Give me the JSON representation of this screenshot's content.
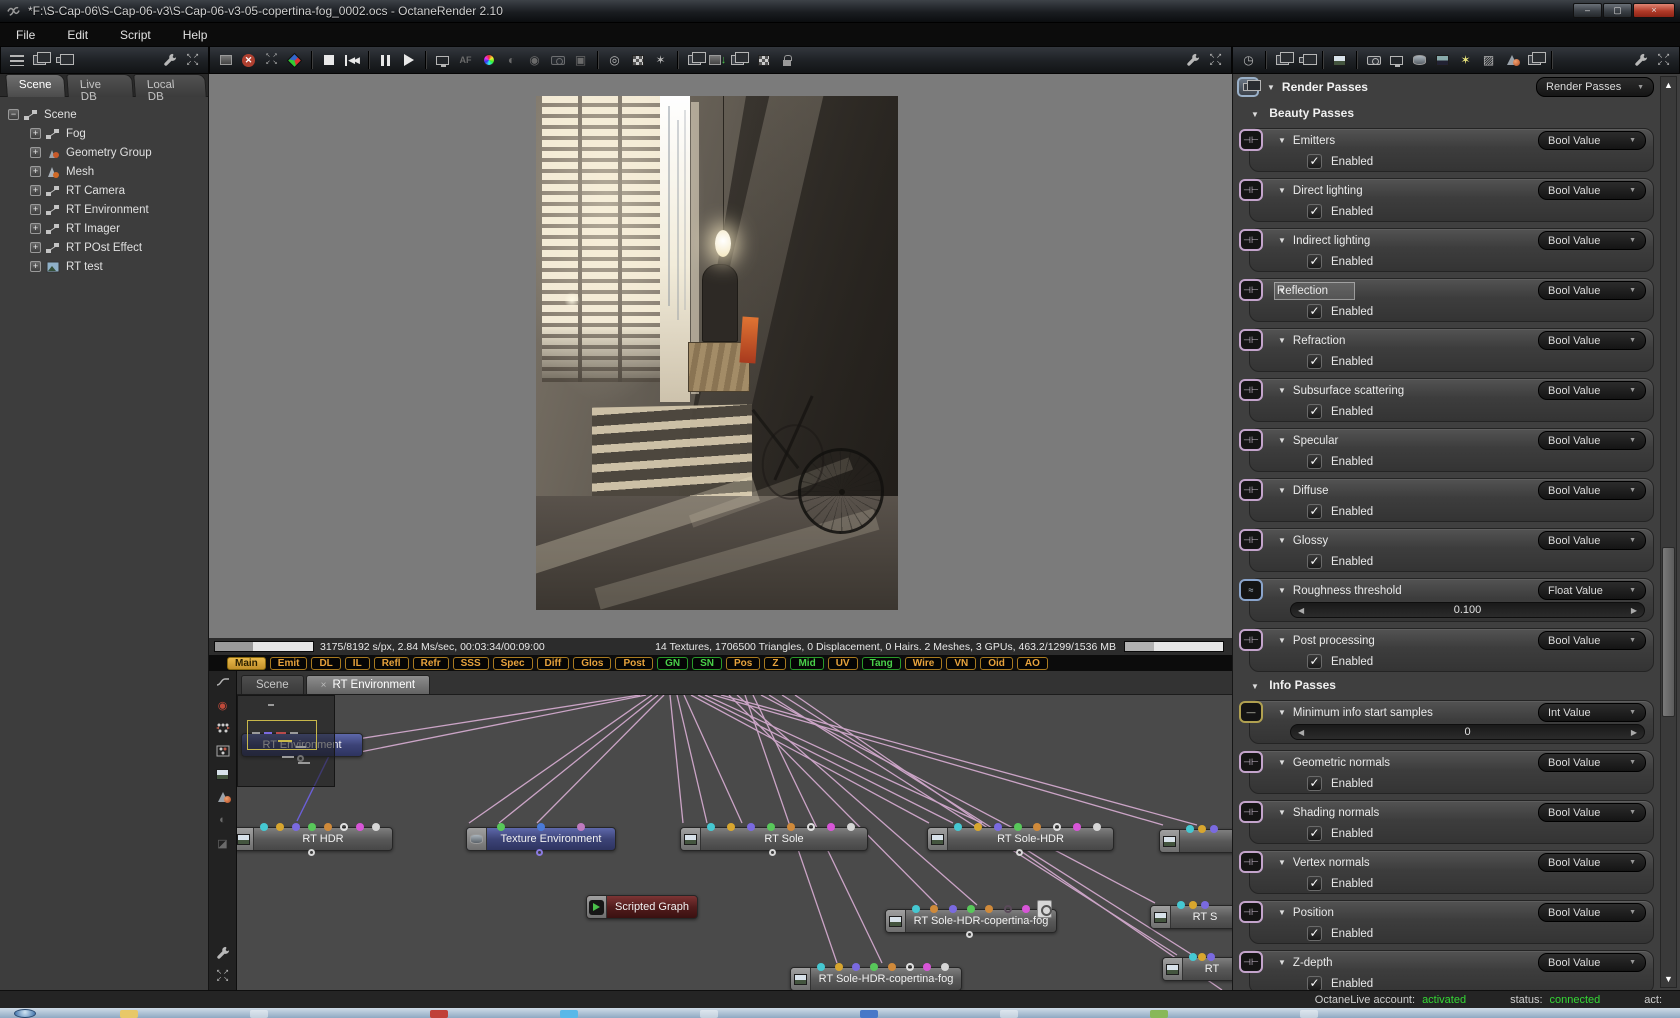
{
  "window": {
    "title": "*F:\\S-Cap-06\\S-Cap-06-v3\\S-Cap-06-v3-05-copertina-fog_0002.ocs - OctaneRender 2.10",
    "menus": [
      "File",
      "Edit",
      "Script",
      "Help"
    ],
    "controls": {
      "minimize": "–",
      "maximize": "▢",
      "close": "×"
    }
  },
  "icons": {
    "collapse": "▼",
    "check": "✓",
    "left": "◀",
    "right": "▶",
    "up": "▲",
    "down": "▼",
    "close": "×",
    "rewind": "◀◀",
    "af": "AF",
    "no": "✕"
  },
  "left_panel": {
    "tabs": [
      "Scene",
      "Live DB",
      "Local DB"
    ],
    "tree": [
      {
        "label": "Scene",
        "expander": "−"
      },
      {
        "label": "Fog",
        "expander": "+"
      },
      {
        "label": "Geometry Group",
        "expander": "+"
      },
      {
        "label": "Mesh",
        "expander": "+"
      },
      {
        "label": "RT Camera",
        "expander": "+"
      },
      {
        "label": "RT Environment",
        "expander": "+"
      },
      {
        "label": "RT Imager",
        "expander": "+"
      },
      {
        "label": "RT POst Effect",
        "expander": "+"
      },
      {
        "label": "RT test",
        "expander": "+"
      }
    ]
  },
  "viewport": {
    "status_left": "3175/8192 s/px, 2.84 Ms/sec, 00:03:34/00:09:00",
    "status_right": "14 Textures, 1706500 Triangles, 0 Displacement, 0 Hairs. 2 Meshes, 3 GPUs, 463.2/1299/1536 MB",
    "progress_percent": 39
  },
  "passes_toolbar": [
    {
      "label": "Main",
      "style": "active"
    },
    {
      "label": "Emit",
      "style": "orange"
    },
    {
      "label": "DL",
      "style": "orange"
    },
    {
      "label": "IL",
      "style": "orange"
    },
    {
      "label": "Refl",
      "style": "orange"
    },
    {
      "label": "Refr",
      "style": "orange"
    },
    {
      "label": "SSS",
      "style": "orange"
    },
    {
      "label": "Spec",
      "style": "orange"
    },
    {
      "label": "Diff",
      "style": "orange"
    },
    {
      "label": "Glos",
      "style": "orange"
    },
    {
      "label": "Post",
      "style": "orange"
    },
    {
      "label": "GN",
      "style": "green"
    },
    {
      "label": "SN",
      "style": "green"
    },
    {
      "label": "Pos",
      "style": "orange"
    },
    {
      "label": "Z",
      "style": "orange"
    },
    {
      "label": "Mid",
      "style": "green"
    },
    {
      "label": "UV",
      "style": "orange"
    },
    {
      "label": "Tang",
      "style": "green"
    },
    {
      "label": "Wire",
      "style": "orange"
    },
    {
      "label": "VN",
      "style": "orange"
    },
    {
      "label": "Oid",
      "style": "orange"
    },
    {
      "label": "AO",
      "style": "orange"
    }
  ],
  "nodegraph": {
    "tabs": [
      "Scene",
      "RT Environment"
    ],
    "nodes": [
      {
        "label": "RT HDR"
      },
      {
        "label": "RT Environment"
      },
      {
        "label": "Texture Environment"
      },
      {
        "label": "RT Sole"
      },
      {
        "label": "RT Sole-HDR"
      },
      {
        "label": "Scripted Graph"
      },
      {
        "label": "RT Sole-HDR-copertina-fog"
      },
      {
        "label": "RT Sole-HDR-copertina-fog"
      },
      {
        "label": ""
      },
      {
        "label": "RT S"
      },
      {
        "label": "RT"
      }
    ]
  },
  "inspector": {
    "header": "Render Passes",
    "header_dropdown": "Render Passes",
    "enabled_label": "Enabled",
    "rows": [
      {
        "kind": "section",
        "label": "Beauty Passes"
      },
      {
        "kind": "bool",
        "label": "Emitters",
        "value_type": "Bool Value"
      },
      {
        "kind": "bool",
        "label": "Direct lighting",
        "value_type": "Bool Value"
      },
      {
        "kind": "bool",
        "label": "Indirect lighting",
        "value_type": "Bool Value"
      },
      {
        "kind": "bool",
        "label": "Reflection",
        "value_type": "Bool Value"
      },
      {
        "kind": "bool",
        "label": "Refraction",
        "value_type": "Bool Value"
      },
      {
        "kind": "bool",
        "label": "Subsurface scattering",
        "value_type": "Bool Value"
      },
      {
        "kind": "bool",
        "label": "Specular",
        "value_type": "Bool Value"
      },
      {
        "kind": "bool",
        "label": "Diffuse",
        "value_type": "Bool Value"
      },
      {
        "kind": "bool",
        "label": "Glossy",
        "value_type": "Bool Value"
      },
      {
        "kind": "float",
        "label": "Roughness threshold",
        "value_type": "Float Value",
        "value": "0.100"
      },
      {
        "kind": "bool",
        "label": "Post processing",
        "value_type": "Bool Value"
      },
      {
        "kind": "section",
        "label": "Info Passes"
      },
      {
        "kind": "int",
        "label": "Minimum info start samples",
        "value_type": "Int Value",
        "value": "0"
      },
      {
        "kind": "bool",
        "label": "Geometric normals",
        "value_type": "Bool Value"
      },
      {
        "kind": "bool",
        "label": "Shading normals",
        "value_type": "Bool Value"
      },
      {
        "kind": "bool",
        "label": "Vertex normals",
        "value_type": "Bool Value"
      },
      {
        "kind": "bool",
        "label": "Position",
        "value_type": "Bool Value"
      },
      {
        "kind": "bool",
        "label": "Z-depth",
        "value_type": "Bool Value"
      }
    ]
  },
  "statusbar": {
    "account_label": "OctaneLive account:",
    "account_value": "activated",
    "status_label": "status:",
    "status_value": "connected",
    "act_label": "act:"
  },
  "colors": {
    "pass_orange": "#e8a33d",
    "pass_green": "#4ad04a",
    "status_green": "#35d835",
    "wire_pink": "#d9aed4",
    "node_blue": "#3c4377",
    "node_maroon": "#521c1c",
    "active_pass_bg": "#d8a030"
  }
}
